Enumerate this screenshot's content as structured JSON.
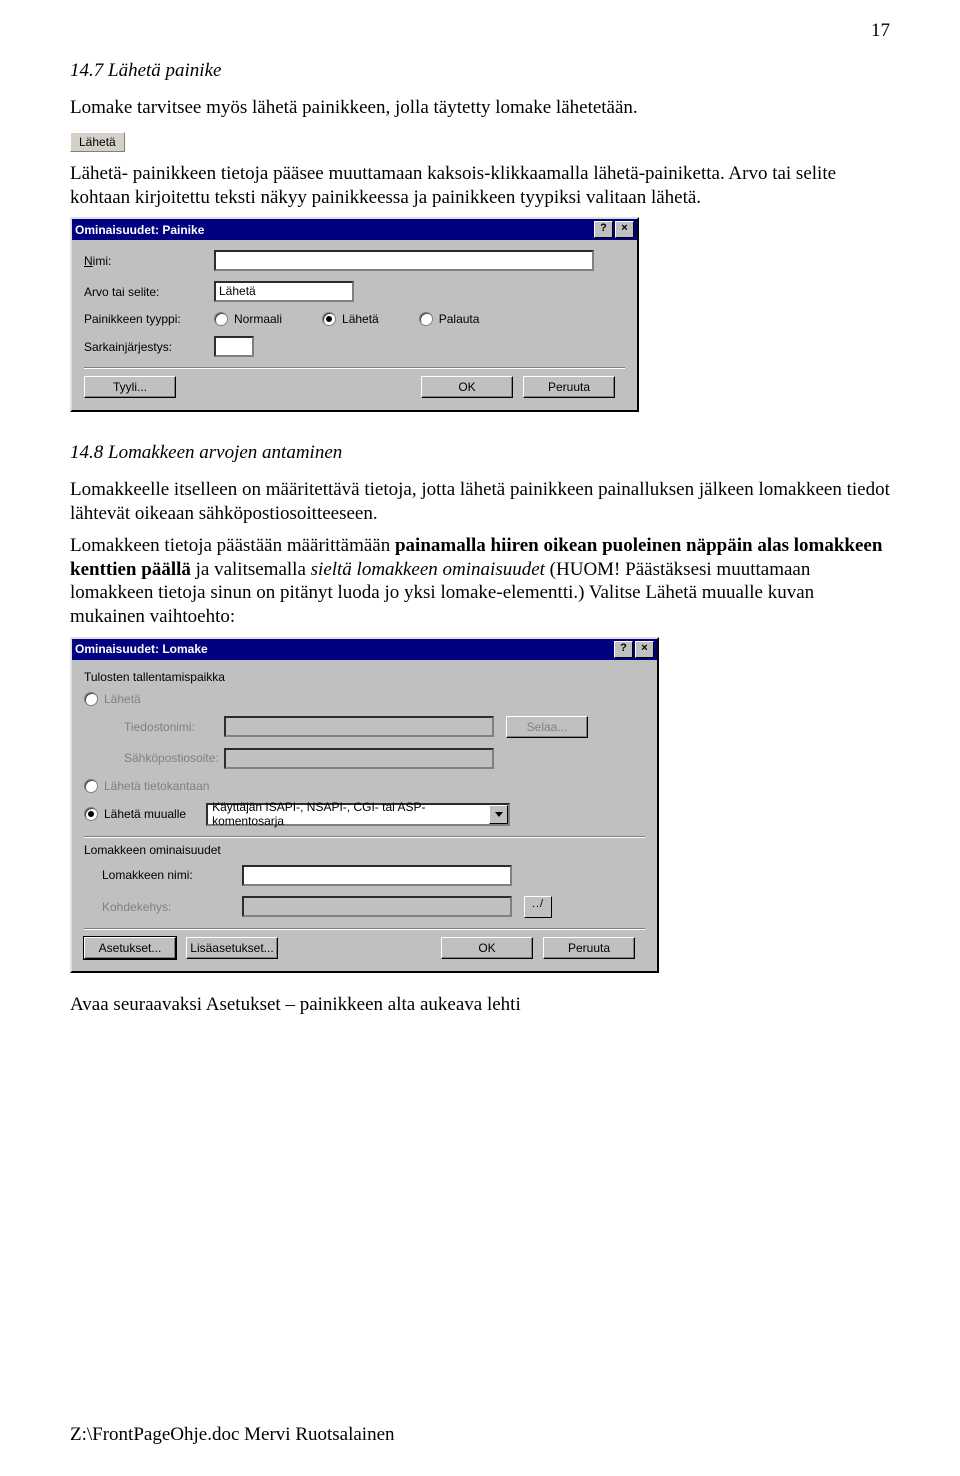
{
  "page_number": "17",
  "heading1": "14.7 Lähetä painike",
  "para1": "Lomake tarvitsee myös lähetä painikkeen, jolla täytetty lomake lähetetään.",
  "send_btn_small": "Lähetä",
  "para2": "Lähetä- painikkeen tietoja pääsee muuttamaan kaksois-klikkaamalla lähetä-painiketta. Arvo tai selite kohtaan kirjoitettu teksti näkyy painikkeessa ja painikkeen tyypiksi valitaan lähetä.",
  "dlg1": {
    "title": "Ominaisuudet: Painike",
    "help": "?",
    "close": "×",
    "lbl_name": "Nimi:",
    "val_name": "",
    "lbl_value": "Arvo tai selite:",
    "val_value": "Lähetä",
    "lbl_type": "Painikkeen tyyppi:",
    "type_normal": "Normaali",
    "type_send": "Lähetä",
    "type_reset": "Palauta",
    "lbl_tab": "Sarkainjärjestys:",
    "val_tab": "",
    "btn_style": "Tyyli...",
    "btn_ok": "OK",
    "btn_cancel": "Peruuta"
  },
  "heading2": "14.8 Lomakkeen arvojen antaminen",
  "para3": "Lomakkeelle itselleen on määritettävä tietoja, jotta lähetä painikkeen painalluksen jälkeen lomakkeen tiedot lähtevät oikeaan sähköpostiosoitteeseen.",
  "para4": "Lomakkeen tietoja päästään määrittämään painamalla hiiren oikean puoleinen näppäin alas lomakkeen kenttien päällä ja valitsemalla sieltä lomakkeen ominaisuudet (HUOM! Päästäksesi muuttamaan lomakkeen tietoja sinun on pitänyt luoda jo yksi lomake-elementti.) Valitse Lähetä muualle kuvan mukainen vaihtoehto:",
  "dlg2": {
    "title": "Ominaisuudet: Lomake",
    "group1": "Tulosten tallentamispaikka",
    "opt_send": "Lähetä",
    "lbl_filename": "Tiedostonimi:",
    "val_filename": "",
    "btn_browse": "Selaa...",
    "lbl_email": "Sähköpostiosoite:",
    "val_email": "",
    "opt_db": "Lähetä tietokantaan",
    "opt_elsewhere": "Lähetä muualle",
    "combo_val": "Käyttäjän ISAPI-, NSAPI-, CGI- tai ASP-komentosarja",
    "group2": "Lomakkeen ominaisuudet",
    "lbl_formname": "Lomakkeen nimi:",
    "val_formname": "",
    "lbl_target": "Kohdekehys:",
    "val_target": "",
    "btn_settings": "Asetukset...",
    "btn_adv": "Lisäasetukset...",
    "btn_ok": "OK",
    "btn_cancel": "Peruuta"
  },
  "para5": "Avaa seuraavaksi Asetukset – painikkeen alta aukeava lehti",
  "footer": "Z:\\FrontPageOhje.doc Mervi Ruotsalainen"
}
